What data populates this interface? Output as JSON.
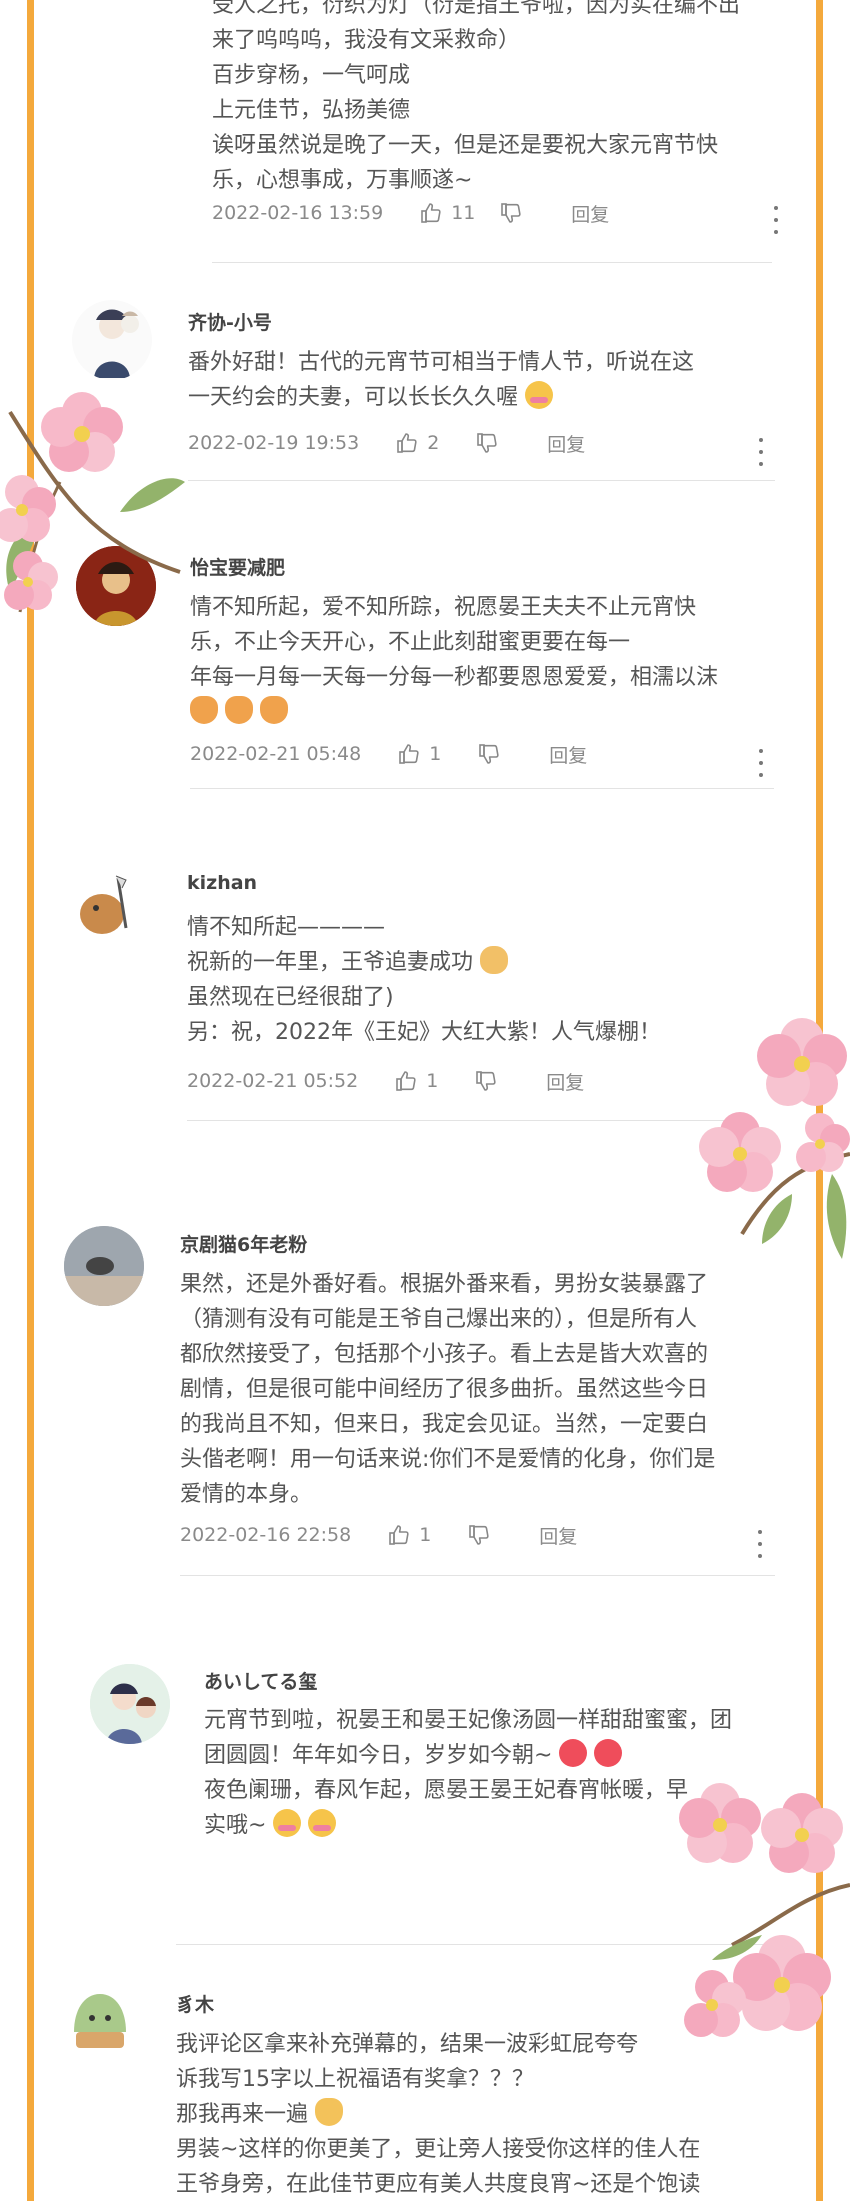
{
  "comments": [
    {
      "username": "",
      "lines": [
        "受人之托，衍织为灯（衍是指王爷啦，因为实在编不出",
        "来了呜呜呜，我没有文采救命）",
        "百步穿杨，一气呵成",
        "上元佳节，弘扬美德",
        "诶呀虽然说是晚了一天，但是还是要祝大家元宵节快",
        "乐，心想事成，万事顺遂~"
      ],
      "date": "2022-02-16 13:59",
      "likes": "11",
      "reply": "回复"
    },
    {
      "username": "齐协-小号",
      "lines": [
        "番外好甜！古代的元宵节可相当于情人节，听说在这",
        "一天约会的夫妻，可以长长久久喔"
      ],
      "date": "2022-02-19 19:53",
      "likes": "2",
      "reply": "回复"
    },
    {
      "username": "怡宝要减肥",
      "lines": [
        "情不知所起，爱不知所踪，祝愿晏王夫夫不止元宵快",
        "乐，不止今天开心，不止此刻甜蜜更要在每一",
        "年每一月每一天每一分每一秒都要恩恩爱爱，相濡以沫",
        ""
      ],
      "date": "2022-02-21 05:48",
      "likes": "1",
      "reply": "回复"
    },
    {
      "username": "kizhan",
      "lines": [
        "情不知所起————",
        "祝新的一年里，王爷追妻成功",
        "虽然现在已经很甜了)",
        "另：祝，2022年《王妃》大红大紫！人气爆棚！"
      ],
      "date": "2022-02-21 05:52",
      "likes": "1",
      "reply": "回复"
    },
    {
      "username": "京剧猫6年老粉",
      "lines": [
        "果然，还是外番好看。根据外番来看，男扮女装暴露了",
        "（猜测有没有可能是王爷自己爆出来的），但是所有人",
        "都欣然接受了，包括那个小孩子。看上去是皆大欢喜的",
        "剧情，但是很可能中间经历了很多曲折。虽然这些今日",
        "的我尚且不知，但来日，我定会见证。当然，一定要白",
        "头偕老啊！用一句话来说:你们不是爱情的化身，你们是",
        "爱情的本身。"
      ],
      "date": "2022-02-16 22:58",
      "likes": "1",
      "reply": "回复"
    },
    {
      "username": "あいしてる玺",
      "lines": [
        "元宵节到啦，祝晏王和晏王妃像汤圆一样甜甜蜜蜜，团",
        "团圆圆！年年如今日，岁岁如今朝~",
        "夜色阑珊，春风乍起，愿晏王晏王妃春宵帐暖，早",
        "实哦~"
      ],
      "date": "",
      "likes": "",
      "reply": ""
    },
    {
      "username": "豸木",
      "lines": [
        "我评论区拿来补充弹幕的，结果一波彩虹屁夸夸",
        "诉我写15字以上祝福语有奖拿？？？",
        "那我再来一遍",
        "男装~这样的你更美了，更让旁人接受你这样的佳人在",
        "王爷身旁，在此佳节更应有美人共度良宵~还是个饱读"
      ],
      "date": "",
      "likes": "",
      "reply": ""
    }
  ],
  "colors": {
    "frame": "#f4a93c",
    "text": "#555555",
    "meta": "#8a8a8a",
    "divider": "#e3e3e3"
  },
  "icons": [
    "thumbs-up-icon",
    "thumbs-down-icon",
    "more-options-icon",
    "cherry-blossom-decoration"
  ]
}
